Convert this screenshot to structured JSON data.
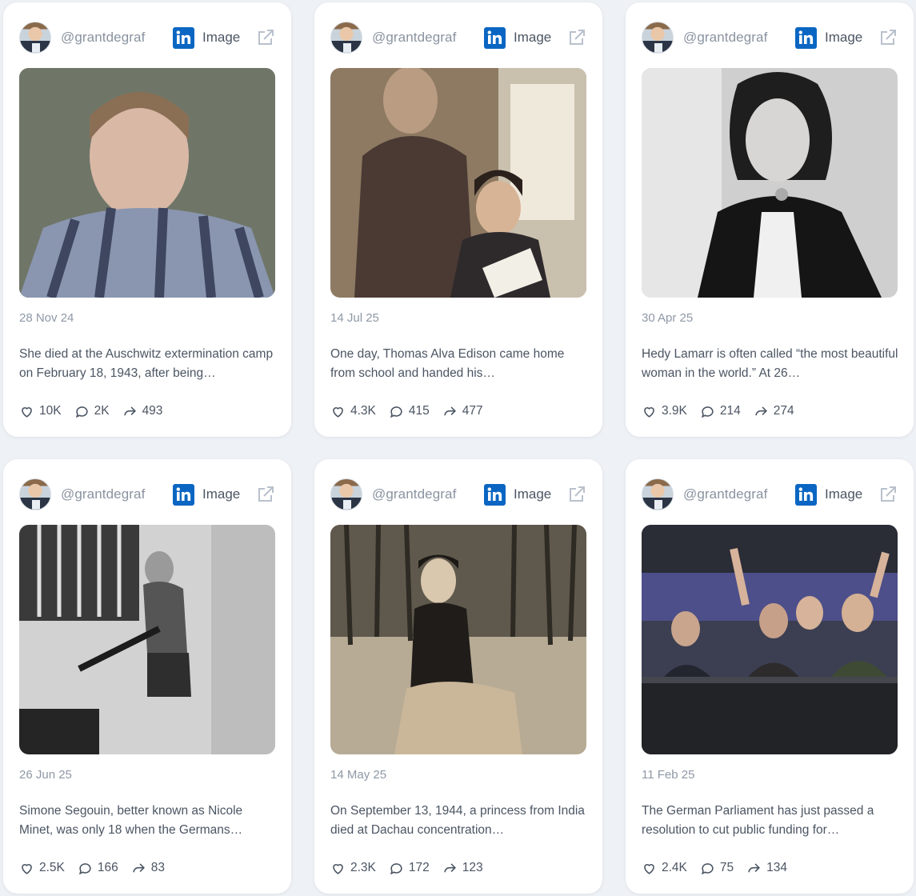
{
  "posts": [
    {
      "handle": "@grantdegraf",
      "type_label": "Image",
      "date": "28 Nov 24",
      "text": "She died at the Auschwitz extermination camp on February 18, 1943, after being…",
      "likes": "10K",
      "comments": "2K",
      "shares": "493"
    },
    {
      "handle": "@grantdegraf",
      "type_label": "Image",
      "date": "14 Jul 25",
      "text": "One day, Thomas Alva Edison came home from school and handed his…",
      "likes": "4.3K",
      "comments": "415",
      "shares": "477"
    },
    {
      "handle": "@grantdegraf",
      "type_label": "Image",
      "date": "30 Apr 25",
      "text": "Hedy Lamarr is often called “the most beautiful woman in the world.” At 26…",
      "likes": "3.9K",
      "comments": "214",
      "shares": "274"
    },
    {
      "handle": "@grantdegraf",
      "type_label": "Image",
      "date": "26 Jun 25",
      "text": "Simone Segouin, better known as Nicole Minet, was only 18 when the Germans…",
      "likes": "2.5K",
      "comments": "166",
      "shares": "83"
    },
    {
      "handle": "@grantdegraf",
      "type_label": "Image",
      "date": "14 May 25",
      "text": "On September 13, 1944, a princess from India died at Dachau concentration…",
      "likes": "2.3K",
      "comments": "172",
      "shares": "123"
    },
    {
      "handle": "@grantdegraf",
      "type_label": "Image",
      "date": "11 Feb 25",
      "text": "The German Parliament has just passed a resolution to cut public funding for…",
      "likes": "2.4K",
      "comments": "75",
      "shares": "134"
    }
  ],
  "colors": {
    "linkedin": "#0a66c2",
    "muted": "#8e98a6",
    "text": "#4b5563"
  },
  "icons": {
    "platform": "linkedin-icon",
    "external": "external-link-icon",
    "like": "heart-icon",
    "comment": "comment-icon",
    "share": "share-icon"
  }
}
